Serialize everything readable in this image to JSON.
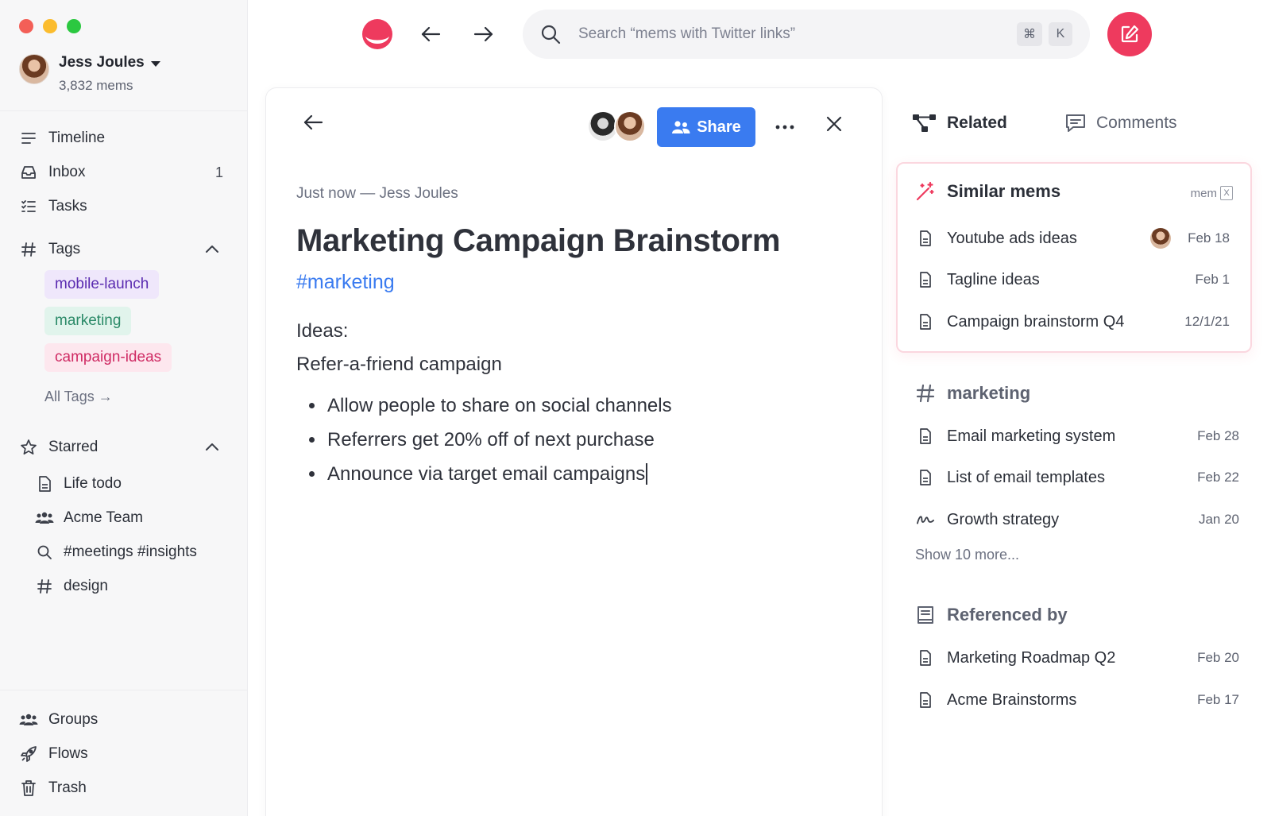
{
  "sidebar": {
    "user": {
      "name": "Jess Joules",
      "count": "3,832 mems"
    },
    "nav": [
      {
        "label": "Timeline",
        "icon": "timeline-icon"
      },
      {
        "label": "Inbox",
        "icon": "inbox-icon",
        "badge": "1"
      },
      {
        "label": "Tasks",
        "icon": "tasks-icon"
      }
    ],
    "tags_section": {
      "label": "Tags"
    },
    "tags": [
      {
        "label": "mobile-launch",
        "color": "#5a2bb0"
      },
      {
        "label": "marketing",
        "color": "#2b8a68"
      },
      {
        "label": "campaign-ideas",
        "color": "#cf2a63"
      }
    ],
    "all_tags": "All Tags →",
    "starred_section": {
      "label": "Starred"
    },
    "starred": [
      {
        "label": "Life todo",
        "icon": "document-icon"
      },
      {
        "label": "Acme Team",
        "icon": "people-icon"
      },
      {
        "label": "#meetings #insights",
        "icon": "search-icon"
      },
      {
        "label": "design",
        "icon": "hashtag-icon"
      }
    ],
    "bottom": [
      {
        "label": "Groups",
        "icon": "groups-icon"
      },
      {
        "label": "Flows",
        "icon": "rocket-icon"
      },
      {
        "label": "Trash",
        "icon": "trash-icon"
      }
    ]
  },
  "topbar": {
    "search_placeholder": "Search “mems with Twitter links”",
    "shortcut_keys": [
      "⌘",
      "K"
    ],
    "accent": "#ee3a5e"
  },
  "mem": {
    "share_label": "Share",
    "meta": "Just now — Jess Joules",
    "title": "Marketing Campaign Brainstorm",
    "hashtag": "#marketing",
    "lines": [
      "Ideas:",
      "Refer-a-friend campaign"
    ],
    "bullets": [
      "Allow people to share on social channels",
      "Referrers get 20% off of next purchase",
      "Announce via target email campaigns"
    ],
    "share_color": "#3a7bf0"
  },
  "panel": {
    "tabs": [
      {
        "label": "Related",
        "active": true
      },
      {
        "label": "Comments",
        "active": false
      }
    ],
    "similar": {
      "title": "Similar mems",
      "badge": "mem",
      "badge_x": "X",
      "items": [
        {
          "label": "Youtube ads ideas",
          "date": "Feb 18"
        },
        {
          "label": "Tagline ideas",
          "date": "Feb 1"
        },
        {
          "label": "Campaign brainstorm Q4",
          "date": "12/1/21"
        }
      ]
    },
    "marketing": {
      "title": "marketing",
      "items": [
        {
          "label": "Email marketing system",
          "date": "Feb 28",
          "icon": "document-icon"
        },
        {
          "label": "List of email templates",
          "date": "Feb 22",
          "icon": "document-icon"
        },
        {
          "label": "Growth strategy",
          "date": "Jan 20",
          "icon": "squiggle-icon"
        }
      ],
      "show_more": "Show 10 more..."
    },
    "referenced": {
      "title": "Referenced by",
      "items": [
        {
          "label": "Marketing Roadmap Q2",
          "date": "Feb 20"
        },
        {
          "label": "Acme Brainstorms",
          "date": "Feb 17"
        }
      ]
    }
  }
}
